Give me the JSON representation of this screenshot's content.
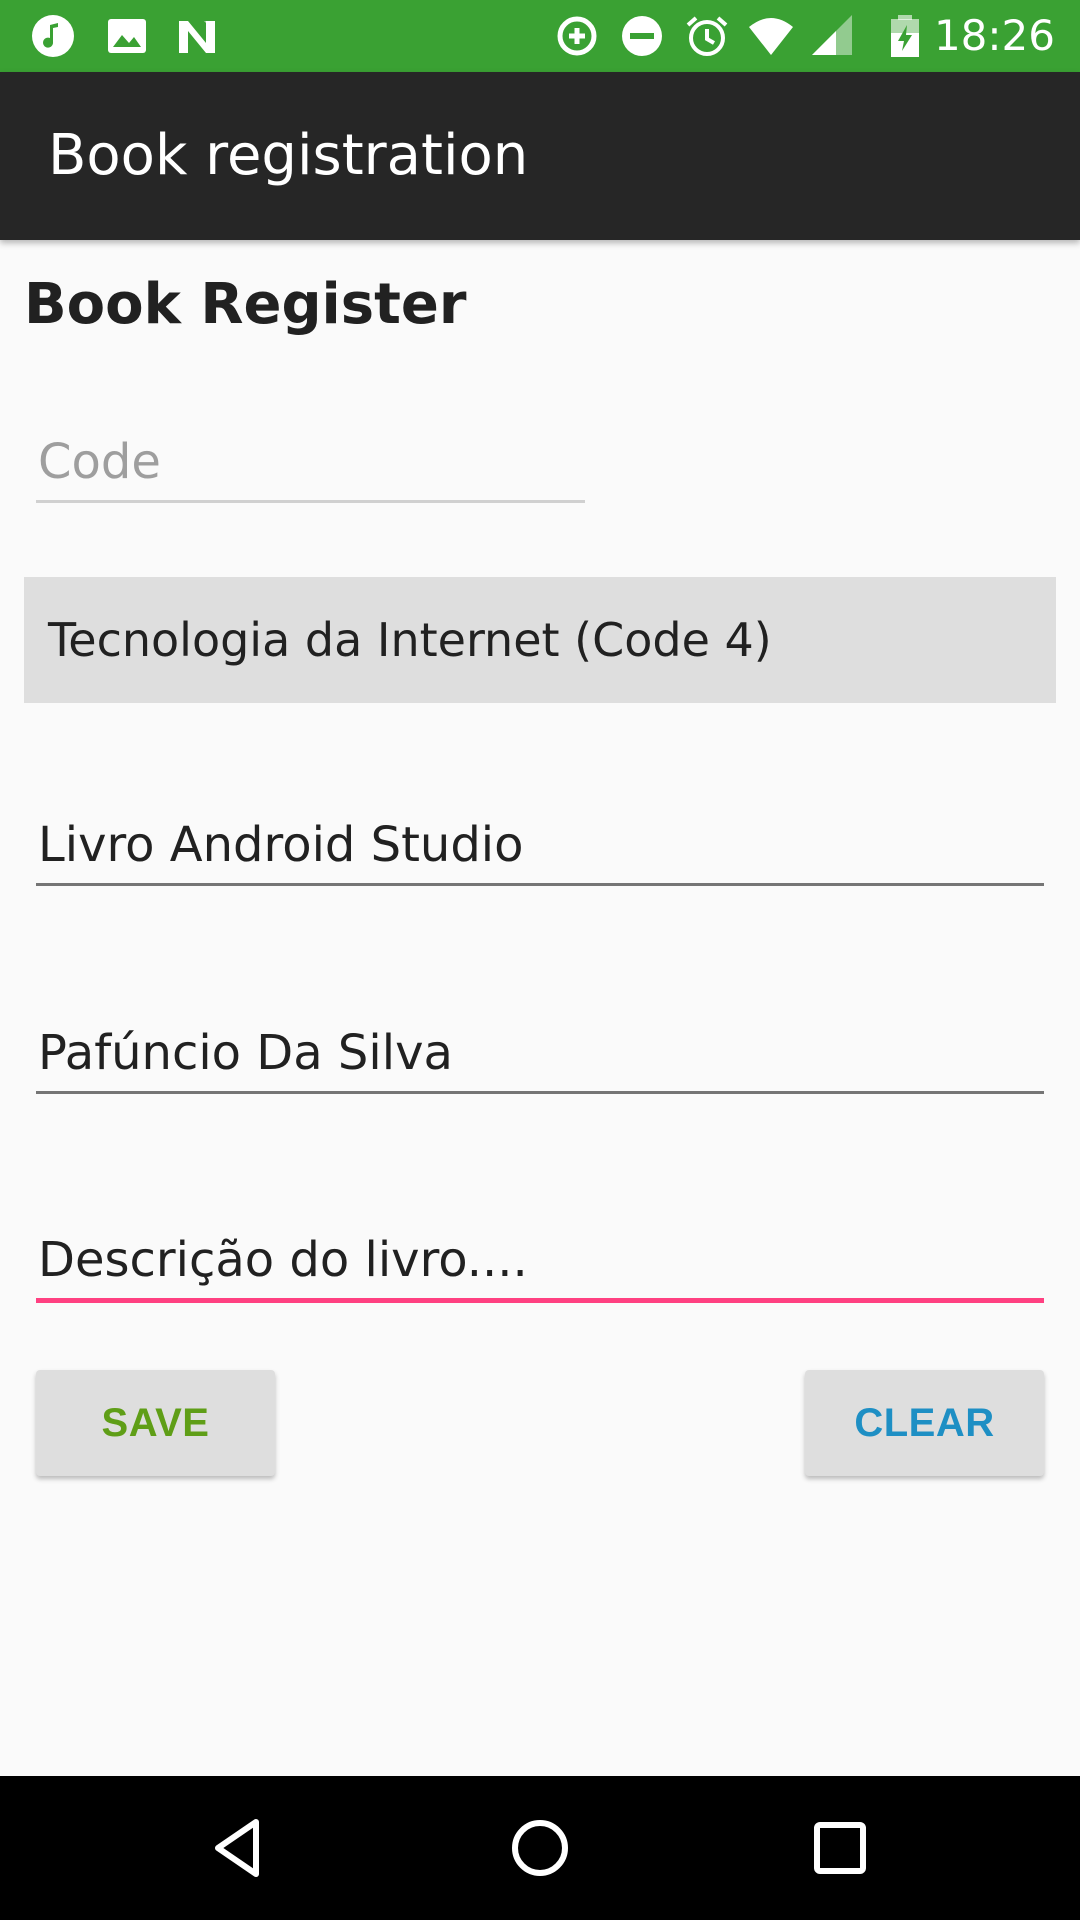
{
  "status_bar": {
    "time": "18:26",
    "left_icons": [
      "music-note-icon",
      "image-icon",
      "n-notification-icon"
    ],
    "right_icons": [
      "data-saver-icon",
      "do-not-disturb-icon",
      "alarm-icon",
      "wifi-icon",
      "signal-icon",
      "battery-charging-icon"
    ],
    "color": "#3aa133"
  },
  "app_bar": {
    "title": "Book registration",
    "color": "#262626"
  },
  "form": {
    "heading": "Book Register",
    "code_placeholder": "Code",
    "category_selected": "Tecnologia da Internet (Code 4)",
    "title_value": "Livro Android Studio",
    "author_value": "Pafúncio Da Silva",
    "description_value": "Descrição do livro....",
    "accent_color": "#ff4081"
  },
  "buttons": {
    "save_label": "SAVE",
    "clear_label": "CLEAR"
  },
  "nav_bar": {
    "icons": [
      "back-icon",
      "home-icon",
      "recents-icon"
    ]
  }
}
